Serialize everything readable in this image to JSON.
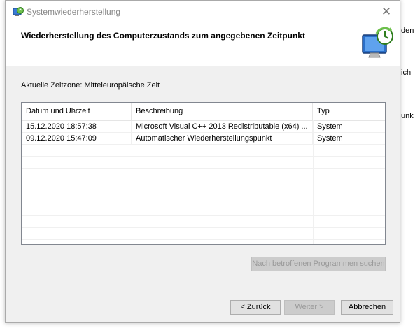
{
  "background_window": {
    "fragments": [
      "den",
      "ich",
      "unk"
    ]
  },
  "dialog": {
    "title": "Systemwiederherstellung",
    "close_glyph": "✕",
    "header_title": "Wiederherstellung des Computerzustands zum angegebenen Zeitpunkt",
    "timezone_label": "Aktuelle Zeitzone: Mitteleuropäische Zeit"
  },
  "table": {
    "columns": [
      "Datum und Uhrzeit",
      "Beschreibung",
      "Typ"
    ],
    "sort_indicator": "⌄",
    "rows": [
      [
        "15.12.2020 18:57:38",
        "Microsoft Visual C++ 2013 Redistributable (x64) ...",
        "System"
      ],
      [
        "09.12.2020 15:47:09",
        "Automatischer Wiederherstellungspunkt",
        "System"
      ]
    ]
  },
  "buttons": {
    "scan": "Nach betroffenen Programmen suchen",
    "back": "< Zurück",
    "next": "Weiter >",
    "cancel": "Abbrechen"
  },
  "icons": {
    "title": "system-restore-icon",
    "header": "system-restore-monitor-icon"
  }
}
